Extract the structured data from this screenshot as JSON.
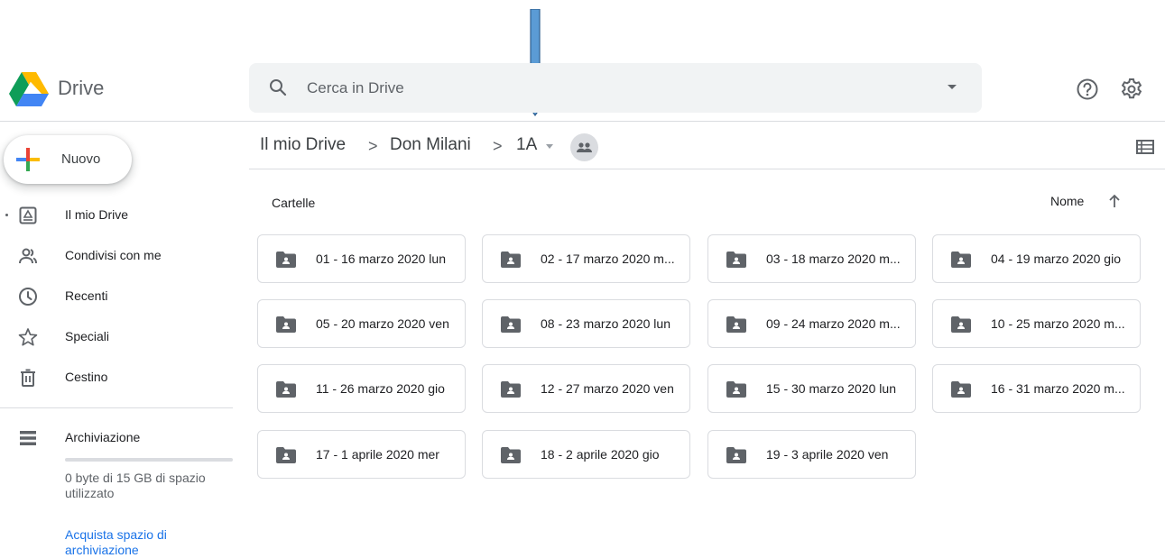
{
  "header": {
    "app_name": "Drive",
    "search_placeholder": "Cerca in Drive"
  },
  "sidebar": {
    "new_label": "Nuovo",
    "items": [
      {
        "label": "Il mio Drive",
        "icon": "my-drive-icon"
      },
      {
        "label": "Condivisi con me",
        "icon": "shared-with-me-icon"
      },
      {
        "label": "Recenti",
        "icon": "clock-icon"
      },
      {
        "label": "Speciali",
        "icon": "star-icon"
      },
      {
        "label": "Cestino",
        "icon": "trash-icon"
      }
    ],
    "storage": {
      "label": "Archiviazione",
      "usage_text": "0 byte di 15 GB di spazio utilizzato",
      "buy_link": "Acquista spazio di archiviazione",
      "used_fraction": 0
    }
  },
  "breadcrumb": {
    "items": [
      "Il mio Drive",
      "Don Milani",
      "1A"
    ],
    "separator": ">"
  },
  "content": {
    "section_title": "Cartelle",
    "sort_label": "Nome",
    "folders": [
      "01 - 16 marzo 2020 lun",
      "02 - 17 marzo 2020 m...",
      "03 - 18 marzo 2020 m...",
      "04 - 19 marzo 2020 gio",
      "05 - 20 marzo 2020 ven",
      "08 - 23 marzo 2020 lun",
      "09 - 24 marzo 2020 m...",
      "10 - 25 marzo 2020 m...",
      "11 - 26 marzo 2020 gio",
      "12 - 27 marzo 2020 ven",
      "15 - 30 marzo 2020 lun",
      "16 - 31 marzo 2020 m...",
      "17 - 1 aprile 2020 mer",
      "18 - 2 aprile 2020 gio",
      "19 - 3 aprile 2020 ven"
    ]
  },
  "colors": {
    "accent": "#1a73e8",
    "arrow": "#5b9bd5",
    "folder_icon": "#5f6368"
  }
}
